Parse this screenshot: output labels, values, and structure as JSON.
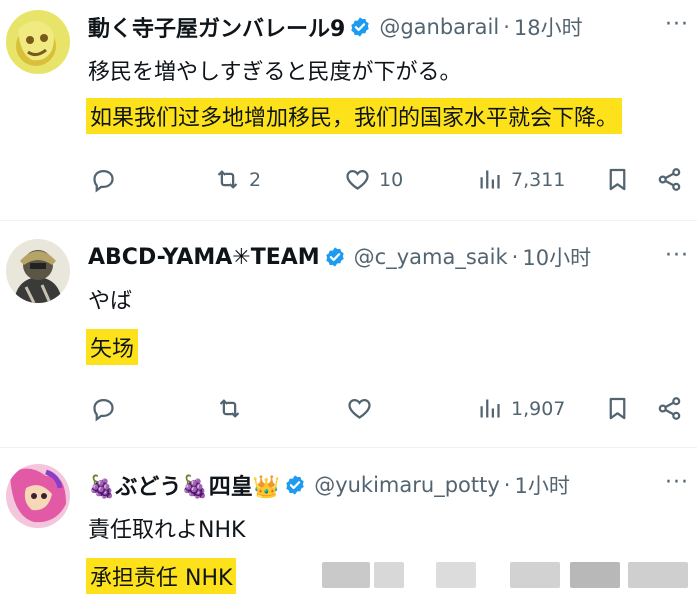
{
  "tweets": [
    {
      "name": "動く寺子屋ガンバレール9",
      "handle": "@ganbarail",
      "time": "18小时",
      "text": "移民を増やしすぎると民度が下がる。",
      "translation": "如果我们过多地增加移民，我们的国家水平就会下降。",
      "retweets": "2",
      "likes": "10",
      "views": "7,311",
      "more": "···"
    },
    {
      "name": "ABCD-YAMA✳TEAM",
      "handle": "@c_yama_saik",
      "time": "10小时",
      "text": "やば",
      "translation": "矢场",
      "retweets": "",
      "likes": "",
      "views": "1,907",
      "more": "···"
    },
    {
      "name": "🍇ぶどう🍇四皇👑",
      "handle": "@yukimaru_potty",
      "time": "1小时",
      "text": "責任取れよNHK",
      "translation": "承担责任 NHK",
      "more": "···"
    }
  ],
  "separator": "·",
  "icons": {
    "verified": "verified-badge-icon",
    "reply": "reply-icon",
    "retweet": "retweet-icon",
    "like": "heart-icon",
    "views": "views-icon",
    "bookmark": "bookmark-icon",
    "share": "share-icon"
  },
  "colors": {
    "verified": "#1d9bf0",
    "highlight": "#fde21b",
    "secondary_text": "#536471"
  }
}
